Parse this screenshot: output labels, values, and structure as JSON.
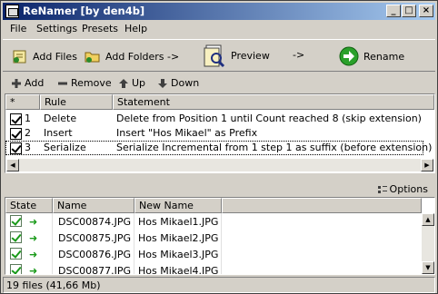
{
  "window": {
    "title": "ReNamer  [by den4b]"
  },
  "titlebar_buttons": {
    "minimize": "_",
    "maximize": "□",
    "close": "×"
  },
  "menu": [
    "File",
    "Settings",
    "Presets",
    "Help"
  ],
  "toolbar": {
    "add_files": "Add Files",
    "add_folders": "Add Folders ->",
    "preview": "Preview",
    "arrow": "->",
    "rename": "Rename"
  },
  "rule_actions": {
    "add": "Add",
    "remove": "Remove",
    "up": "Up",
    "down": "Down"
  },
  "rules_table": {
    "headers": {
      "star": "*",
      "rule": "Rule",
      "statement": "Statement"
    },
    "rows": [
      {
        "num": "1",
        "rule": "Delete",
        "statement": "Delete from Position 1 until Count reached 8 (skip extension)",
        "checked": true
      },
      {
        "num": "2",
        "rule": "Insert",
        "statement": "Insert \"Hos Mikael\" as Prefix",
        "checked": true
      },
      {
        "num": "3",
        "rule": "Serialize",
        "statement": "Serialize Incremental from 1 step 1 as suffix (before extension)",
        "checked": true
      }
    ]
  },
  "options_label": "Options",
  "files_table": {
    "headers": {
      "state": "State",
      "name": "Name",
      "new_name": "New Name"
    },
    "rows": [
      {
        "name": "DSC00874.JPG",
        "new_name": "Hos Mikael1.JPG"
      },
      {
        "name": "DSC00875.JPG",
        "new_name": "Hos Mikael2.JPG"
      },
      {
        "name": "DSC00876.JPG",
        "new_name": "Hos Mikael3.JPG"
      },
      {
        "name": "DSC00877.JPG",
        "new_name": "Hos Mikael4.JPG"
      }
    ]
  },
  "status": "19 files (41,66 Mb)",
  "colors": {
    "title_start": "#0a246a",
    "title_end": "#a6caf0",
    "check_green": "#1a9a1a"
  }
}
